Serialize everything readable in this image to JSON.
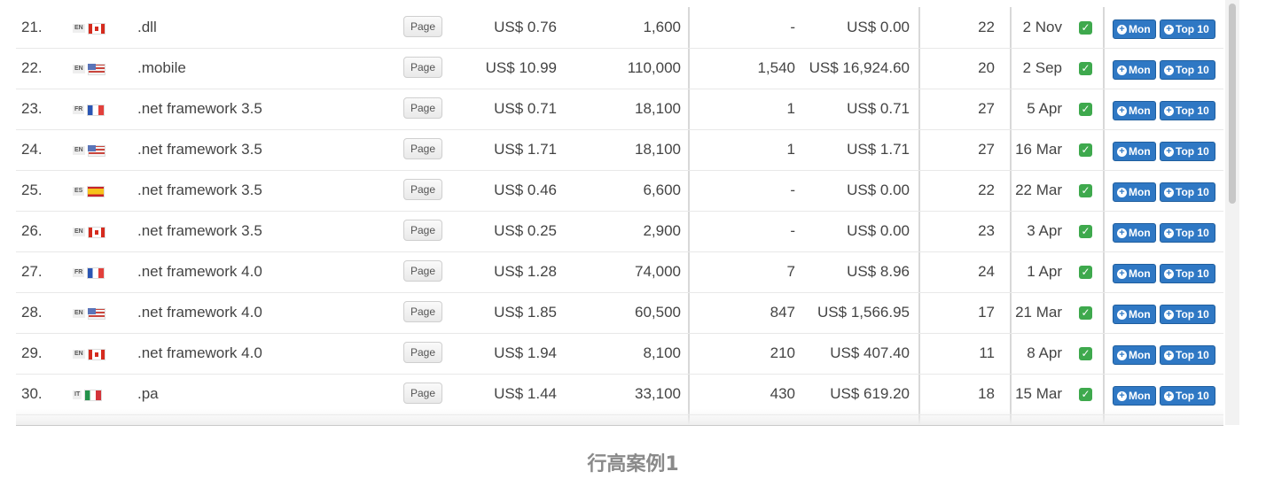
{
  "table": {
    "page_button_label": "Page",
    "mon_button_label": "Mon",
    "top10_button_label": "Top 10",
    "rows": [
      {
        "index": "21.",
        "lang": "EN",
        "flag": "ca",
        "keyword": ".dll",
        "cpc": "US$ 0.76",
        "volume": "1,600",
        "clicks": "-",
        "value": "US$ 0.00",
        "position": "22",
        "date": "2 Nov"
      },
      {
        "index": "22.",
        "lang": "EN",
        "flag": "us",
        "keyword": ".mobile",
        "cpc": "US$ 10.99",
        "volume": "110,000",
        "clicks": "1,540",
        "value": "US$ 16,924.60",
        "position": "20",
        "date": "2 Sep"
      },
      {
        "index": "23.",
        "lang": "FR",
        "flag": "fr",
        "keyword": ".net framework 3.5",
        "cpc": "US$ 0.71",
        "volume": "18,100",
        "clicks": "1",
        "value": "US$ 0.71",
        "position": "27",
        "date": "5 Apr"
      },
      {
        "index": "24.",
        "lang": "EN",
        "flag": "us",
        "keyword": ".net framework 3.5",
        "cpc": "US$ 1.71",
        "volume": "18,100",
        "clicks": "1",
        "value": "US$ 1.71",
        "position": "27",
        "date": "16 Mar"
      },
      {
        "index": "25.",
        "lang": "ES",
        "flag": "es",
        "keyword": ".net framework 3.5",
        "cpc": "US$ 0.46",
        "volume": "6,600",
        "clicks": "-",
        "value": "US$ 0.00",
        "position": "22",
        "date": "22 Mar"
      },
      {
        "index": "26.",
        "lang": "EN",
        "flag": "ca",
        "keyword": ".net framework 3.5",
        "cpc": "US$ 0.25",
        "volume": "2,900",
        "clicks": "-",
        "value": "US$ 0.00",
        "position": "23",
        "date": "3 Apr"
      },
      {
        "index": "27.",
        "lang": "FR",
        "flag": "fr",
        "keyword": ".net framework 4.0",
        "cpc": "US$ 1.28",
        "volume": "74,000",
        "clicks": "7",
        "value": "US$ 8.96",
        "position": "24",
        "date": "1 Apr"
      },
      {
        "index": "28.",
        "lang": "EN",
        "flag": "us",
        "keyword": ".net framework 4.0",
        "cpc": "US$ 1.85",
        "volume": "60,500",
        "clicks": "847",
        "value": "US$ 1,566.95",
        "position": "17",
        "date": "21 Mar"
      },
      {
        "index": "29.",
        "lang": "EN",
        "flag": "ca",
        "keyword": ".net framework 4.0",
        "cpc": "US$ 1.94",
        "volume": "8,100",
        "clicks": "210",
        "value": "US$ 407.40",
        "position": "11",
        "date": "8 Apr"
      },
      {
        "index": "30.",
        "lang": "IT",
        "flag": "it",
        "keyword": ".pa",
        "cpc": "US$ 1.44",
        "volume": "33,100",
        "clicks": "430",
        "value": "US$ 619.20",
        "position": "18",
        "date": "15 Mar"
      }
    ]
  },
  "caption": "行高案例1",
  "colors": {
    "accent_button": "#2f78c4",
    "check": "#3ea94d",
    "text": "#444444"
  }
}
